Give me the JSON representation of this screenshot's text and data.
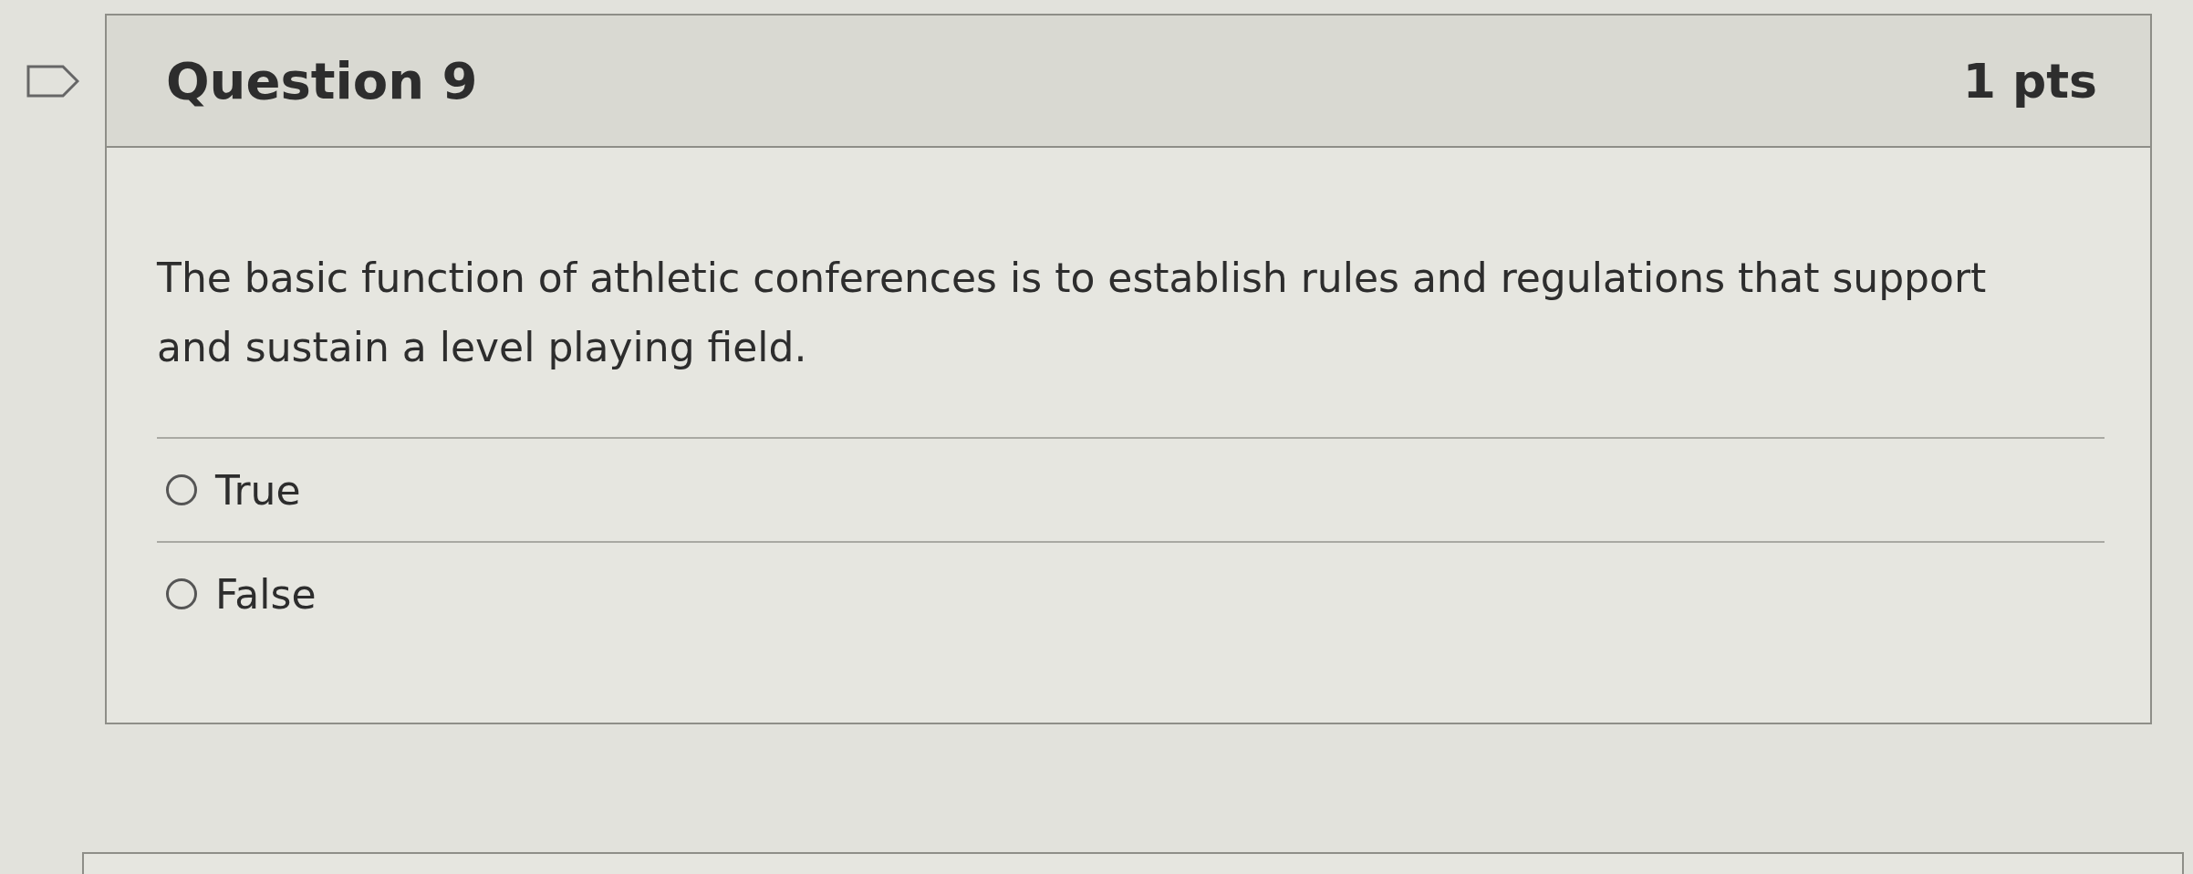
{
  "question": {
    "title": "Question 9",
    "points": "1 pts",
    "flagged": false,
    "text": "The basic function of athletic conferences is to establish rules and regulations that support and sustain a level playing field.",
    "answers": [
      {
        "label": "True",
        "selected": false
      },
      {
        "label": "False",
        "selected": false
      }
    ]
  }
}
